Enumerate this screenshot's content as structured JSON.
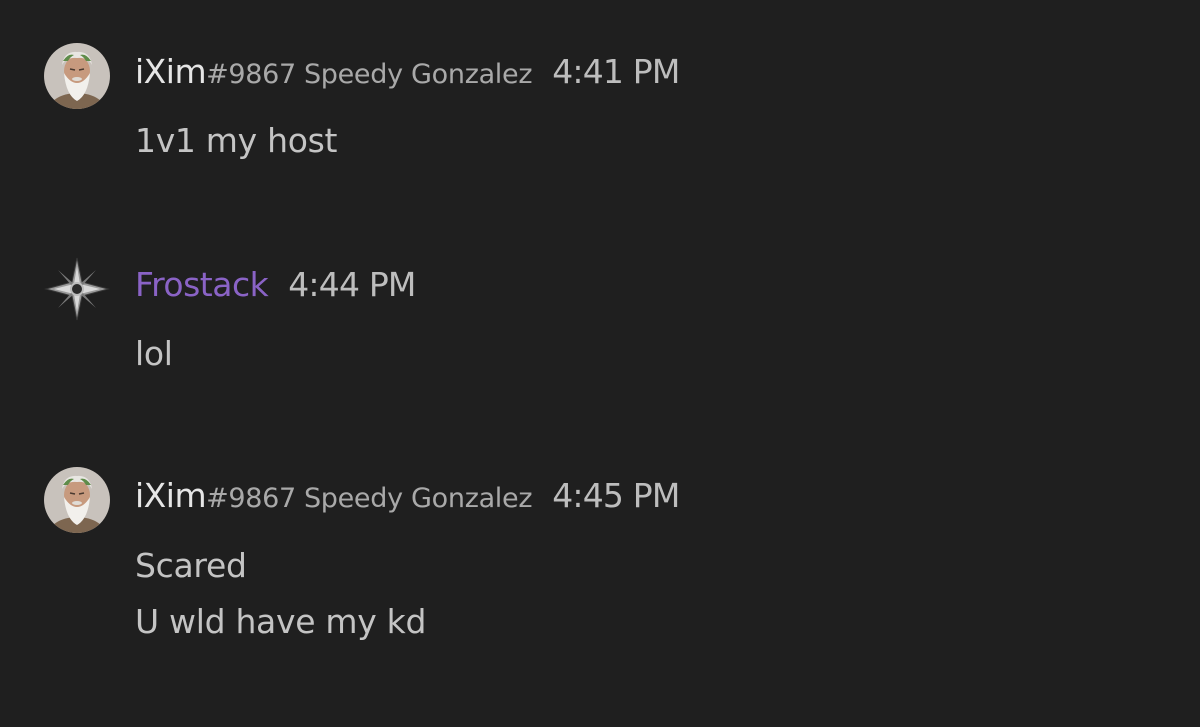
{
  "colors": {
    "background": "#1f1f1f",
    "username_default": "#e6e6e6",
    "username_frostack": "#8a63c6",
    "secondary_text": "#a9a9a9",
    "timestamp": "#bdbdbd",
    "message_text": "#c4c4c4"
  },
  "messages": [
    {
      "avatar_icon": "bearded-god-avatar-icon",
      "username": "iXim",
      "discriminator": "#9867",
      "nickname": "Speedy Gonzalez",
      "timestamp": "4:41 PM",
      "lines": [
        "1v1 my host"
      ]
    },
    {
      "avatar_icon": "silver-star-emblem-avatar-icon",
      "username": "Frostack",
      "discriminator": "",
      "nickname": "",
      "timestamp": "4:44 PM",
      "lines": [
        "lol"
      ]
    },
    {
      "avatar_icon": "bearded-god-avatar-icon",
      "username": "iXim",
      "discriminator": "#9867",
      "nickname": "Speedy Gonzalez",
      "timestamp": "4:45 PM",
      "lines": [
        "Scared",
        "U wld have my kd"
      ]
    }
  ]
}
